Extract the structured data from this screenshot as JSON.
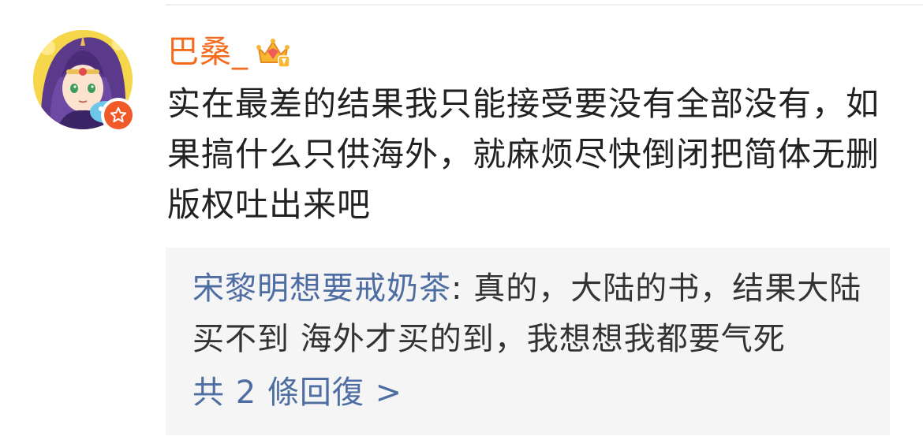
{
  "user": {
    "name": "巴桑_",
    "avatar_icon": "anime-character-avatar",
    "badge_icon": "star-badge-icon",
    "level_icon": "crown-gem-icon",
    "name_color": "#f36b1c"
  },
  "comment": {
    "text": "实在最差的结果我只能接受要没有全部没有，如果搞什么只供海外，就麻烦尽快倒闭把简体无删版权吐出来吧"
  },
  "reply_preview": {
    "author": "宋黎明想要戒奶茶",
    "separator": ": ",
    "text": "真的，大陆的书，结果大陆买不到 海外才买的到，我想想我都要气死",
    "count_label": "共 2 條回復 >",
    "author_color": "#4e6ea3"
  }
}
